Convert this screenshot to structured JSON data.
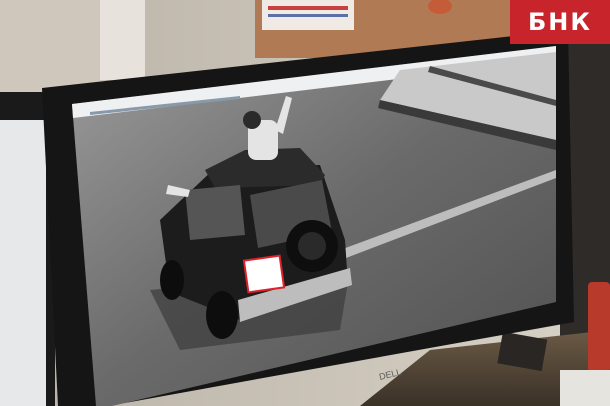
{
  "watermark": {
    "text": "БНК",
    "color": "#c7242c"
  },
  "photo": {
    "subject": "monitor-showing-traffic-camera-frame",
    "plate_highlight_color": "#e0202a"
  }
}
